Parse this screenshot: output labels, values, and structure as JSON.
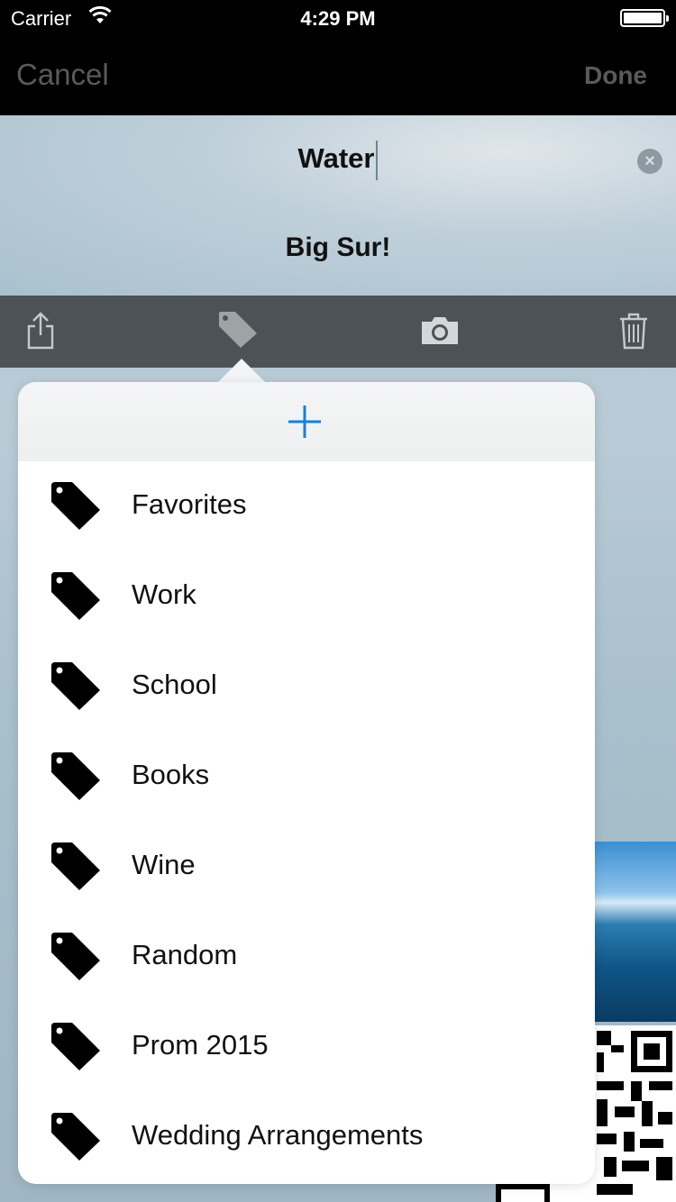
{
  "status_bar": {
    "carrier": "Carrier",
    "time": "4:29 PM"
  },
  "nav": {
    "cancel_label": "Cancel",
    "done_label": "Done"
  },
  "note": {
    "title_value": "Water",
    "subtitle": "Big Sur!"
  },
  "toolbar": {
    "icons": [
      "share-icon",
      "tag-icon",
      "camera-icon",
      "trash-icon"
    ]
  },
  "tag_popover": {
    "add_icon": "plus-icon",
    "tags": [
      {
        "label": "Favorites"
      },
      {
        "label": "Work"
      },
      {
        "label": "School"
      },
      {
        "label": "Books"
      },
      {
        "label": "Wine"
      },
      {
        "label": "Random"
      },
      {
        "label": "Prom 2015"
      },
      {
        "label": "Wedding Arrangements"
      }
    ]
  },
  "colors": {
    "accent_plus": "#1a7fd8",
    "toolbar_bg": "#4c5255",
    "nav_bg": "#000000"
  }
}
